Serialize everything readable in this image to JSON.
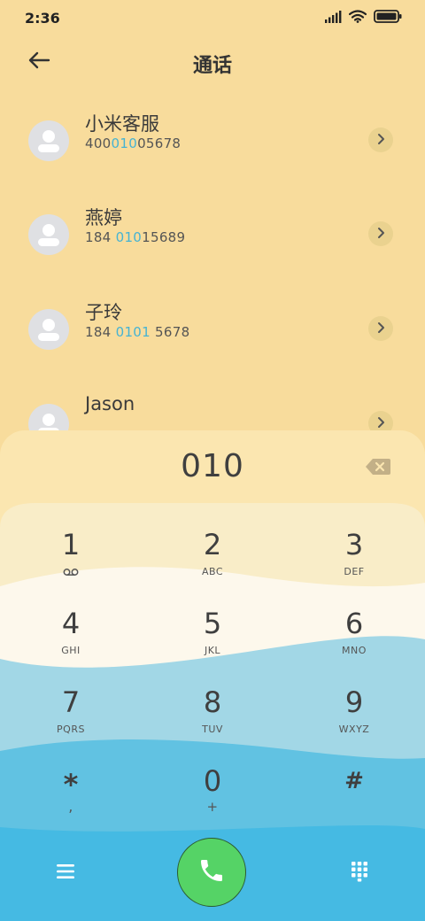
{
  "status_bar": {
    "time": "2:36",
    "icons": [
      "signal-icon",
      "wifi-icon",
      "battery-icon"
    ]
  },
  "header": {
    "title": "通话",
    "back_icon": "arrow-left-icon"
  },
  "contacts": [
    {
      "name": "小米客服",
      "number_parts": [
        "400",
        "010",
        "05678"
      ]
    },
    {
      "name": "燕婷",
      "number_parts": [
        "184 ",
        "010",
        "15689"
      ]
    },
    {
      "name": "子玲",
      "number_parts": [
        "184 ",
        "0101",
        " 5678"
      ]
    },
    {
      "name": "Jason",
      "number_parts": [
        "",
        "",
        ""
      ]
    }
  ],
  "dialer": {
    "input_value": "010",
    "keys": [
      {
        "digit": "1",
        "letters": ""
      },
      {
        "digit": "2",
        "letters": "ABC"
      },
      {
        "digit": "3",
        "letters": "DEF"
      },
      {
        "digit": "4",
        "letters": "GHI"
      },
      {
        "digit": "5",
        "letters": "JKL"
      },
      {
        "digit": "6",
        "letters": "MNO"
      },
      {
        "digit": "7",
        "letters": "PQRS"
      },
      {
        "digit": "8",
        "letters": "TUV"
      },
      {
        "digit": "9",
        "letters": "WXYZ"
      },
      {
        "digit": "*",
        "letters": ","
      },
      {
        "digit": "0",
        "letters": "+"
      },
      {
        "digit": "#",
        "letters": ""
      }
    ]
  },
  "colors": {
    "background": "#f8dc9c",
    "highlight": "#46b3d3",
    "call_button": "#55d366",
    "wave_cream": "#fdf8ec",
    "wave_light_blue": "#a2d7e6",
    "wave_blue": "#61c2e2",
    "wave_deep_blue": "#45bae3"
  }
}
